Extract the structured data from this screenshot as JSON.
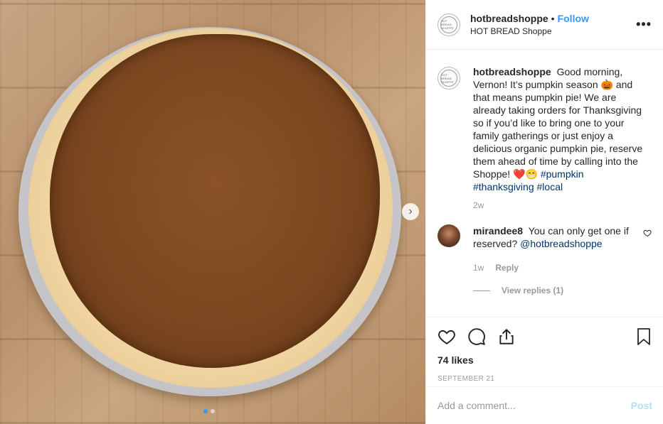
{
  "post": {
    "username": "hotbreadshoppe",
    "bullet": "•",
    "follow_label": "Follow",
    "location": "HOT BREAD Shoppe",
    "more_label": "•••",
    "logo_text": "HOT BREAD SHOPPE"
  },
  "caption": {
    "username": "hotbreadshoppe",
    "text": "Good morning, Vernon! It’s pumpkin season 🎃 and that means pumpkin pie! We are already taking orders for Thanksgiving so if you’d like to bring one to your family gatherings or just enjoy a delicious organic pumpkin pie, reserve them ahead of time by calling into the Shoppe! ❤️😁",
    "hashtags": [
      "#pumpkin",
      "#thanksgiving",
      "#local"
    ],
    "age": "2w"
  },
  "comments": [
    {
      "username": "mirandee8",
      "text": "You can only get one if reserved?",
      "mention": "@hotbreadshoppe",
      "age": "1w",
      "reply_label": "Reply",
      "view_replies": "View replies (1)"
    }
  ],
  "engagement": {
    "likes": "74 likes",
    "date": "SEPTEMBER 21"
  },
  "composer": {
    "placeholder": "Add a comment...",
    "post_label": "Post"
  },
  "carousel": {
    "total_slides": 2,
    "current_slide": 1,
    "next_glyph": "›"
  },
  "colors": {
    "link": "#3897f0",
    "hashtag": "#003569",
    "muted": "#999999",
    "post_disabled": "#b2dffc"
  }
}
